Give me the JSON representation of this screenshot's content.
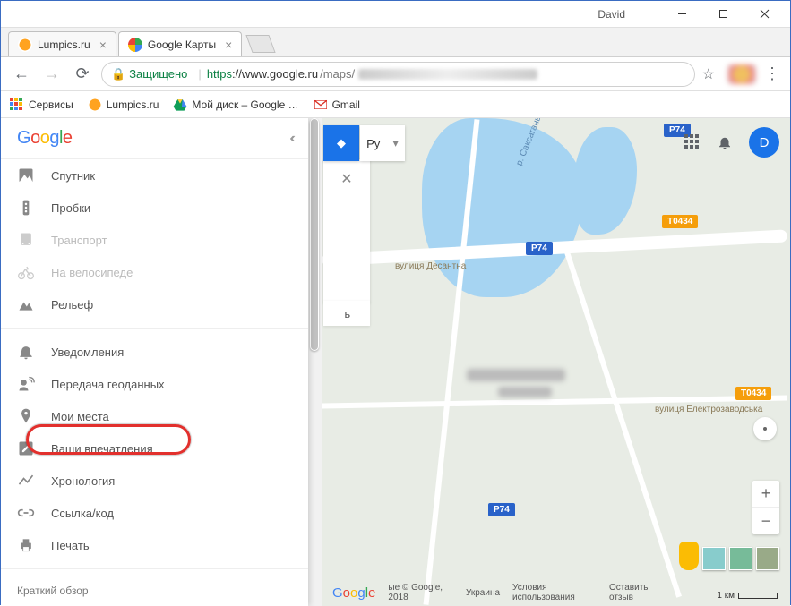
{
  "window": {
    "user": "David"
  },
  "tabs": [
    {
      "title": "Lumpics.ru",
      "active": false
    },
    {
      "title": "Google Карты",
      "active": true
    }
  ],
  "address": {
    "secure_label": "Защищено",
    "protocol": "https",
    "host": "://www.google.ru",
    "path": "/maps/"
  },
  "bookmarks": {
    "apps": "Сервисы",
    "items": [
      {
        "label": "Lumpics.ru"
      },
      {
        "label": "Мой диск – Google …"
      },
      {
        "label": "Gmail"
      }
    ]
  },
  "sidebar": {
    "collapse_glyph": "‹‹",
    "group1": [
      {
        "id": "satellite",
        "label": "Спутник",
        "disabled": false
      },
      {
        "id": "traffic",
        "label": "Пробки",
        "disabled": false
      },
      {
        "id": "transit",
        "label": "Транспорт",
        "disabled": true
      },
      {
        "id": "bike",
        "label": "На велосипеде",
        "disabled": true
      },
      {
        "id": "terrain",
        "label": "Рельеф",
        "disabled": false
      }
    ],
    "group2": [
      {
        "id": "notifications",
        "label": "Уведомления"
      },
      {
        "id": "share-location",
        "label": "Передача геоданных"
      },
      {
        "id": "my-places",
        "label": "Мои места"
      },
      {
        "id": "contributions",
        "label": "Ваши впечатления"
      },
      {
        "id": "timeline",
        "label": "Хронология"
      },
      {
        "id": "link",
        "label": "Ссылка/код"
      },
      {
        "id": "print",
        "label": "Печать"
      }
    ],
    "footer": "Краткий обзор"
  },
  "map_controls": {
    "lang": "Ру",
    "close": "✕",
    "frag": "ъ",
    "user_initial": "D"
  },
  "map_labels": {
    "shield1": "P74",
    "shield2": "T0434",
    "shield3": "P74",
    "shield4": "T0434",
    "shield5": "P74",
    "street1": "вулиця Десантна",
    "street2": "вулиця Електрозаводська",
    "river": "р. Саксагань"
  },
  "attribution": {
    "logo": "Google",
    "copyright": "ые © Google, 2018",
    "country": "Украина",
    "terms": "Условия использования",
    "feedback": "Оставить отзыв",
    "scale": "1 км"
  }
}
